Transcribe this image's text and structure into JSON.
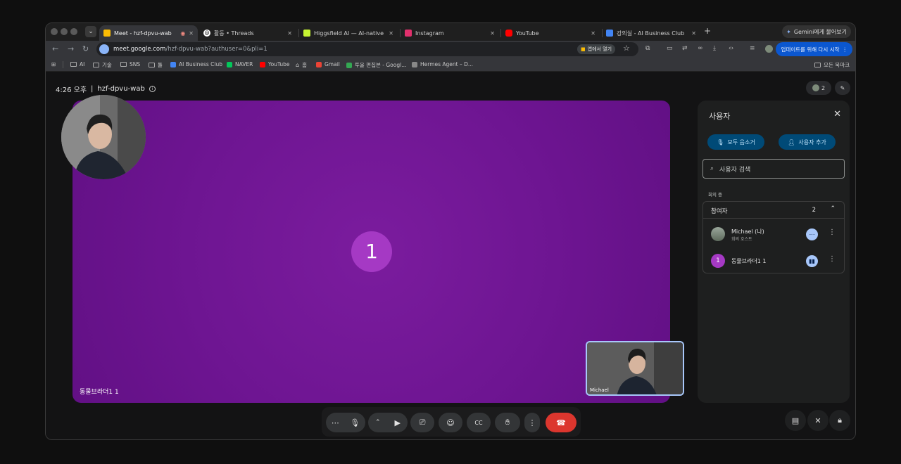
{
  "browser": {
    "tabs": [
      {
        "label": "Meet - hzf-dpvu-wab",
        "favicon_color": "#fbbc04",
        "active": true
      },
      {
        "label": "활동 • Threads",
        "favicon_color": "#ffffff"
      },
      {
        "label": "Higgsfield AI — AI-native crea",
        "favicon_color": "#c6f432"
      },
      {
        "label": "Instagram",
        "favicon_color": "#e1306c"
      },
      {
        "label": "YouTube",
        "favicon_color": "#ff0000"
      },
      {
        "label": "강의실 - AI Business Club",
        "favicon_color": "#4285f4"
      }
    ],
    "gemini_label": "Gemini에게 물어보기",
    "url_host": "meet.google.com",
    "url_path": "/hzf-dpvu-wab?authuser=0&pli=1",
    "open_in_app": "앱에서 열기",
    "restart_label": "업데이트를 위해 다시 시작",
    "bookmarks": [
      {
        "label": "AI",
        "type": "folder"
      },
      {
        "label": "기술",
        "type": "folder"
      },
      {
        "label": "SNS",
        "type": "folder"
      },
      {
        "label": "툴",
        "type": "folder"
      },
      {
        "label": "AI Business Club",
        "type": "site",
        "color": "#4285f4"
      },
      {
        "label": "NAVER",
        "type": "site",
        "color": "#03c75a"
      },
      {
        "label": "YouTube",
        "type": "site",
        "color": "#ff0000"
      },
      {
        "label": "홈",
        "type": "site",
        "color": "#bbbbbb"
      },
      {
        "label": "Gmail",
        "type": "site",
        "color": "#ea4335"
      },
      {
        "label": "투올 편집본 - Googl...",
        "type": "site",
        "color": "#34a853"
      },
      {
        "label": "Hermes Agent – D...",
        "type": "site",
        "color": "#888888"
      }
    ],
    "all_bookmarks": "모든 북마크"
  },
  "meet": {
    "time": "4:26 오후",
    "separator": "|",
    "meeting_code": "hzf-dpvu-wab",
    "participant_count_badge": "2",
    "stage_avatar_label": "1",
    "stage_name": "동물브라더1 1",
    "self_name": "Michael"
  },
  "panel": {
    "title": "사용자",
    "mute_all": "모두 음소거",
    "add_people": "사용자 추가",
    "search_placeholder": "사용자 검색",
    "in_meeting": "회의 중",
    "contributors_label": "참여자",
    "contributors_count": "2",
    "participants": [
      {
        "name": "Michael (나)",
        "role": "회의 호스트",
        "avatar": ""
      },
      {
        "name": "동물브라더1 1",
        "role": "",
        "avatar": "1"
      }
    ]
  },
  "colors": {
    "accent_blue": "#a8c7fa",
    "end_call_red": "#dc362e",
    "stage_purple": "#6e1592",
    "avatar_purple": "#a539c4"
  }
}
